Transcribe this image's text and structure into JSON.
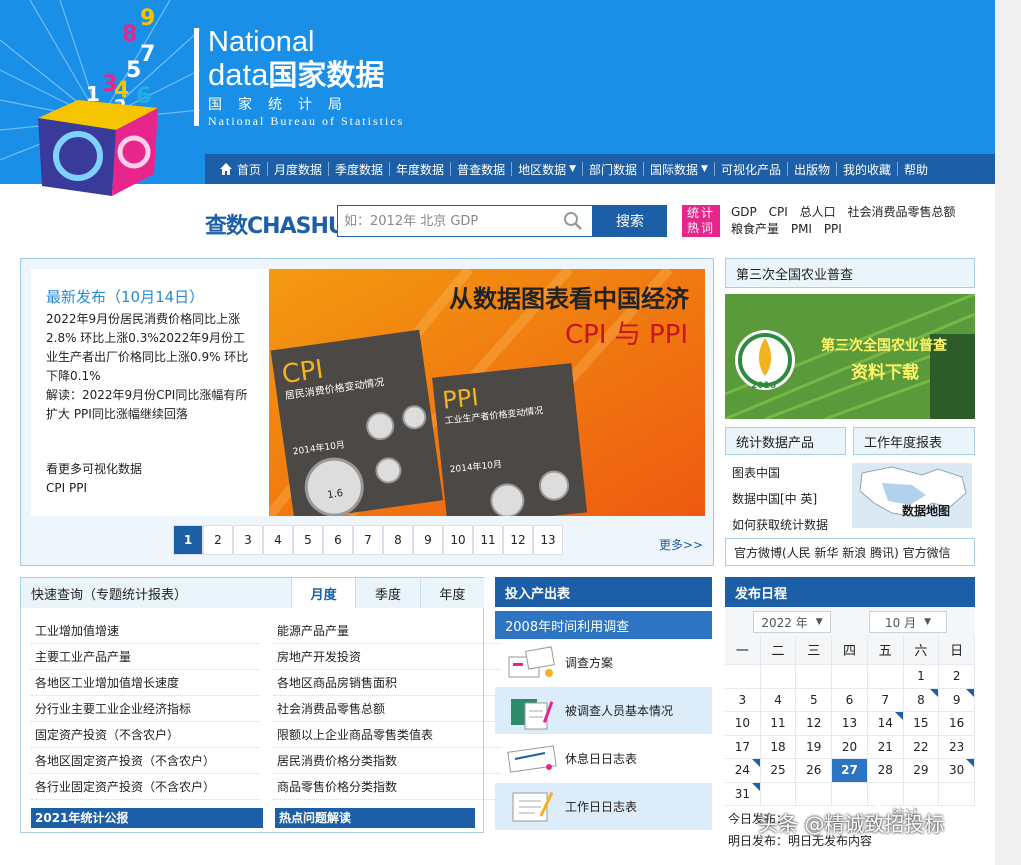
{
  "header": {
    "logo_digits": [
      "1",
      "3",
      "4",
      "5",
      "6",
      "7",
      "8",
      "9",
      "2"
    ],
    "brand_line1": "National",
    "brand_line2_en": "data",
    "brand_line2_cn": "国家数据",
    "brand_line3": "国家统计局",
    "brand_line4": "National Bureau of Statistics"
  },
  "nav": {
    "items": [
      {
        "label": "首页",
        "dropdown": false
      },
      {
        "label": "月度数据",
        "dropdown": false
      },
      {
        "label": "季度数据",
        "dropdown": false
      },
      {
        "label": "年度数据",
        "dropdown": false
      },
      {
        "label": "普查数据",
        "dropdown": false
      },
      {
        "label": "地区数据",
        "dropdown": true
      },
      {
        "label": "部门数据",
        "dropdown": false
      },
      {
        "label": "国际数据",
        "dropdown": true
      },
      {
        "label": "可视化产品",
        "dropdown": false
      },
      {
        "label": "出版物",
        "dropdown": false
      },
      {
        "label": "我的收藏",
        "dropdown": false
      },
      {
        "label": "帮助",
        "dropdown": false
      }
    ]
  },
  "search": {
    "logo_cn": "查数",
    "logo_en": "CHASHU",
    "placeholder": "如：2012年 北京 GDP",
    "button": "搜索",
    "hot_label_1": "统计",
    "hot_label_2": "热词",
    "hot_words": [
      "GDP",
      "CPI",
      "总人口",
      "社会消费品零售总额",
      "粮食产量",
      "PMI",
      "PPI"
    ]
  },
  "feature": {
    "latest_title": "最新发布（10月14日）",
    "latest_text": "2022年9月份居民消费价格同比上涨2.8% 环比上涨0.3%2022年9月份工业生产者出厂价格同比上涨0.9% 环比下降0.1%",
    "latest_analysis": "解读：2022年9月份CPI同比涨幅有所扩大 PPI同比涨幅继续回落",
    "more_vis": "看更多可视化数据",
    "more_vis_links": "CPI  PPI",
    "banner_title": "从数据图表看中国经济",
    "banner_subtitle": "CPI 与 PPI",
    "banner_cpi": "CPI",
    "banner_cpi_sub": "居民消费价格变动情况",
    "banner_ppi": "PPI",
    "banner_ppi_sub": "工业生产者价格变动情况",
    "banner_month_cpi": "2014年10月",
    "banner_month_ppi": "2014年10月",
    "banner_gauge_value": "1.6",
    "pages": [
      "1",
      "2",
      "3",
      "4",
      "5",
      "6",
      "7",
      "8",
      "9",
      "10",
      "11",
      "12",
      "13"
    ],
    "active_page": "1",
    "more": "更多>>"
  },
  "sidebar": {
    "agri_header": "第三次全国农业普查",
    "agri_banner_title": "第三次全国农业普查",
    "agri_banner_action": "资料下载",
    "agri_badge_year": "2016",
    "products_header": "统计数据产品",
    "report_header": "工作年度报表",
    "products": [
      "图表中国",
      "数据中国[中 英]",
      "如何获取统计数据"
    ],
    "map_label": "数据地图",
    "weibo": "官方微博(人民 新华 新浪 腾讯) 官方微信"
  },
  "quick": {
    "title": "快速查询（专题统计报表）",
    "tabs": [
      "月度",
      "季度",
      "年度"
    ],
    "active_tab": "月度",
    "left": [
      "工业增加值增速",
      "主要工业产品产量",
      "各地区工业增加值增长速度",
      "分行业主要工业企业经济指标",
      "固定资产投资（不含农户）",
      "各地区固定资产投资（不含农户）",
      "各行业固定资产投资（不含农户）"
    ],
    "right": [
      "能源产品产量",
      "房地产开发投资",
      "各地区商品房销售面积",
      "社会消费品零售总额",
      "限额以上企业商品零售类值表",
      "居民消费价格分类指数",
      "商品零售价格分类指数"
    ],
    "footer_left": "2021年统计公报",
    "footer_right": "热点问题解读"
  },
  "io": {
    "title": "投入产出表",
    "subtitle": "2008年时间利用调查",
    "items": [
      "调查方案",
      "被调查人员基本情况",
      "休息日日志表",
      "工作日日志表"
    ]
  },
  "calendar": {
    "title": "发布日程",
    "year": "2022 年",
    "month": "10 月",
    "weekdays": [
      "一",
      "二",
      "三",
      "四",
      "五",
      "六",
      "日"
    ],
    "days": [
      "",
      "",
      "",
      "",
      "",
      "1",
      "2",
      "3",
      "4",
      "5",
      "6",
      "7",
      "8",
      "9",
      "10",
      "11",
      "12",
      "13",
      "14",
      "15",
      "16",
      "17",
      "18",
      "19",
      "20",
      "21",
      "22",
      "23",
      "24",
      "25",
      "26",
      "27",
      "28",
      "29",
      "30",
      "31",
      "",
      "",
      "",
      "",
      "",
      ""
    ],
    "marked_days": [
      "8",
      "9",
      "14",
      "24",
      "30",
      "31"
    ],
    "today": "27",
    "today_label": "今日发布：",
    "tomorrow_label": "明日发布：",
    "tomorrow_text": "明日无发布内容"
  },
  "watermark": {
    "text": "头条 @精诚致招投标",
    "icon_text": "精诚"
  }
}
